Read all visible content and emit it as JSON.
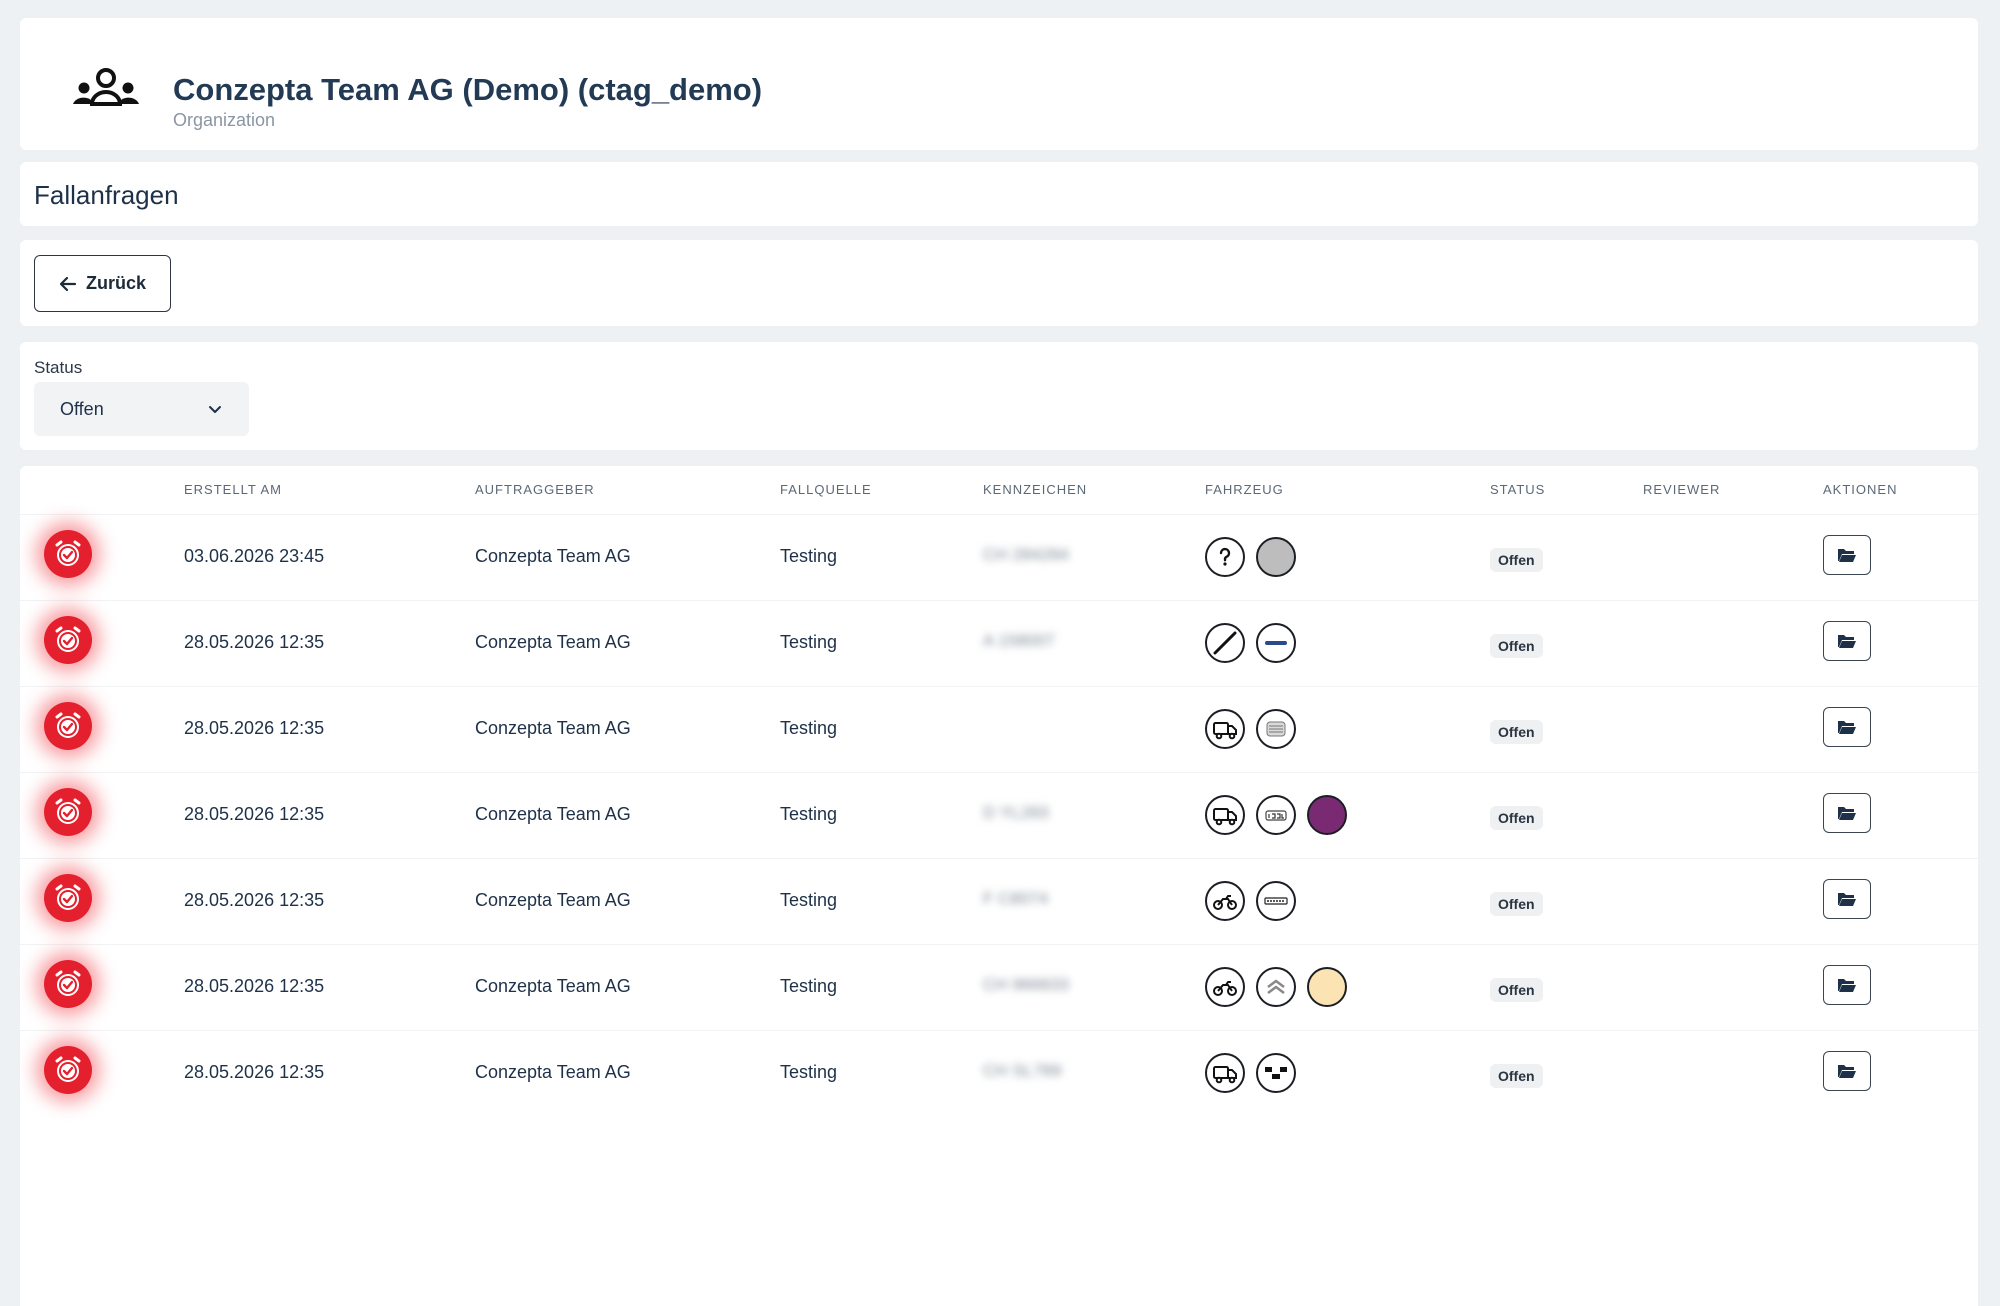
{
  "header": {
    "title": "Conzepta Team AG (Demo) (ctag_demo)",
    "subtitle": "Organization",
    "icon": "users-group-icon"
  },
  "section": {
    "title": "Fallanfragen"
  },
  "back_button": {
    "label": "Zurück",
    "icon": "arrow-left-icon"
  },
  "filter": {
    "label": "Status",
    "value": "Offen",
    "icon": "chevron-down-icon"
  },
  "table": {
    "columns": [
      "ERSTELLT AM",
      "AUFTRAGGEBER",
      "FALLQUELLE",
      "KENNZEICHEN",
      "FAHRZEUG",
      "STATUS",
      "REVIEWER",
      "AKTIONEN"
    ],
    "rows": [
      {
        "created": "03.06.2026 23:45",
        "client": "Conzepta Team AG",
        "source": "Testing",
        "plate": "CH 284284",
        "vehicle_type": "question-icon",
        "brand": "grey-circle",
        "color": "",
        "status": "Offen"
      },
      {
        "created": "28.05.2026 12:35",
        "client": "Conzepta Team AG",
        "source": "Testing",
        "plate": "A 158007",
        "vehicle_type": "no-entry-icon",
        "brand": "westfalia-logo",
        "color": "",
        "status": "Offen"
      },
      {
        "created": "28.05.2026 12:35",
        "client": "Conzepta Team AG",
        "source": "Testing",
        "plate": "",
        "vehicle_type": "truck-icon",
        "brand": "grille-logo",
        "color": "",
        "status": "Offen"
      },
      {
        "created": "28.05.2026 12:35",
        "client": "Conzepta Team AG",
        "source": "Testing",
        "plate": "D YL283",
        "vehicle_type": "truck-icon",
        "brand": "jeep-logo",
        "color": "#7a2a72",
        "status": "Offen"
      },
      {
        "created": "28.05.2026 12:35",
        "client": "Conzepta Team AG",
        "source": "Testing",
        "plate": "F C8074",
        "vehicle_type": "motorcycle-icon",
        "brand": "carthago-logo",
        "color": "",
        "status": "Offen"
      },
      {
        "created": "28.05.2026 12:35",
        "client": "Conzepta Team AG",
        "source": "Testing",
        "plate": "CH 966833",
        "vehicle_type": "motorcycle-icon",
        "brand": "citroen-logo",
        "color": "#fbe3b4",
        "status": "Offen"
      },
      {
        "created": "28.05.2026 12:35",
        "client": "Conzepta Team AG",
        "source": "Testing",
        "plate": "CH SL789",
        "vehicle_type": "truck-icon",
        "brand": "checker-logo",
        "color": "",
        "status": "Offen"
      }
    ],
    "action_icon": "folder-open-icon",
    "alarm_icon": "alarm-clock-check-icon"
  },
  "colors": {
    "alarm": "#e5202e",
    "title": "#233a55",
    "background": "#eef1f4"
  }
}
